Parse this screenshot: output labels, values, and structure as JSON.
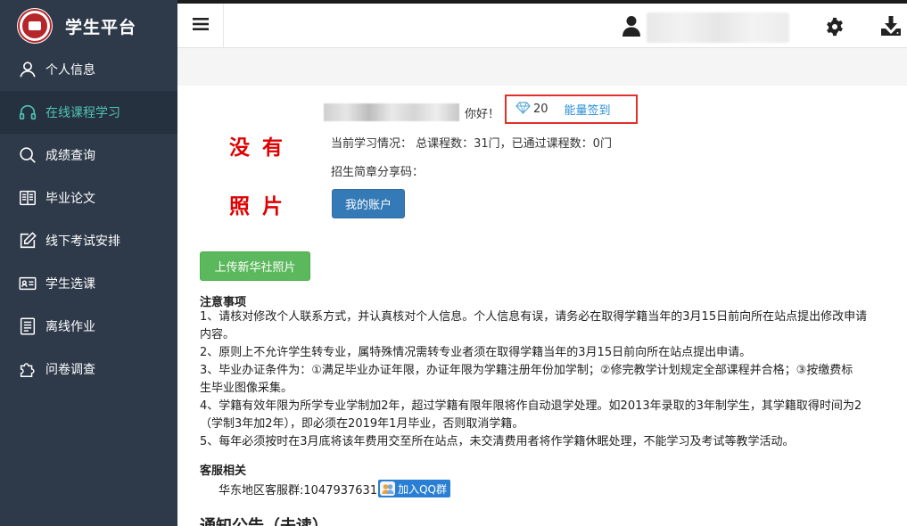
{
  "app": {
    "title": "学生平台"
  },
  "sidebar": {
    "items": [
      {
        "label": "个人信息",
        "icon": "user-icon",
        "active": false
      },
      {
        "label": "在线课程学习",
        "icon": "headphones-icon",
        "active": true
      },
      {
        "label": "成绩查询",
        "icon": "search-icon",
        "active": false
      },
      {
        "label": "毕业论文",
        "icon": "book-icon",
        "active": false
      },
      {
        "label": "线下考试安排",
        "icon": "edit-icon",
        "active": false
      },
      {
        "label": "学生选课",
        "icon": "id-card-icon",
        "active": false
      },
      {
        "label": "离线作业",
        "icon": "document-icon",
        "active": false
      },
      {
        "label": "问卷调查",
        "icon": "puzzle-icon",
        "active": false
      }
    ]
  },
  "colors": {
    "sidebar_bg": "#2e3a4a",
    "active_text": "#4fc3b3",
    "primary_button": "#337ab7",
    "success_button": "#5cb85c",
    "highlight_border": "#e0302a",
    "no_photo_text": "#e00000"
  },
  "profile": {
    "no_photo_line1": "没有",
    "no_photo_line2": "照片",
    "greeting": "你好！",
    "energy_count": "20",
    "energy_sign_in": "能量签到",
    "study_status": "当前学习情况： 总课程数：31门，已通过课程数：0门",
    "share_code": "招生简章分享码：",
    "account_button": "我的账户",
    "upload_button": "上传新华社照片"
  },
  "notice": {
    "title": "注意事项",
    "lines": [
      "1、请核对修改个人联系方式，并认真核对个人信息。个人信息有误，请务必在取得学籍当年的3月15日前向所在站点提出修改申请",
      "内容。",
      "2、原则上不允许学生转专业，属特殊情况需转专业者须在取得学籍当年的3月15日前向所在站点提出申请。",
      "3、毕业办证条件为：①满足毕业办证年限，办证年限为学籍注册年份加学制；②修完教学计划规定全部课程并合格；③按缴费标",
      "生毕业图像采集。",
      "4、学籍有效年限为所学专业学制加2年，超过学籍有限年限将作自动退学处理。如2013年录取的3年制学生，其学籍取得时间为2",
      "（学制3年加2年），即必须在2019年1月毕业，否则取消学籍。",
      "5、每年必须按时在3月底将该年费用交至所在站点，未交清费用者将作学籍休眠处理，不能学习及考试等教学活动。"
    ]
  },
  "service": {
    "title": "客服相关",
    "group_text": "华东地区客服群:1047937631",
    "join_button": "加入QQ群"
  },
  "news": {
    "title": "通知公告（未读）"
  }
}
